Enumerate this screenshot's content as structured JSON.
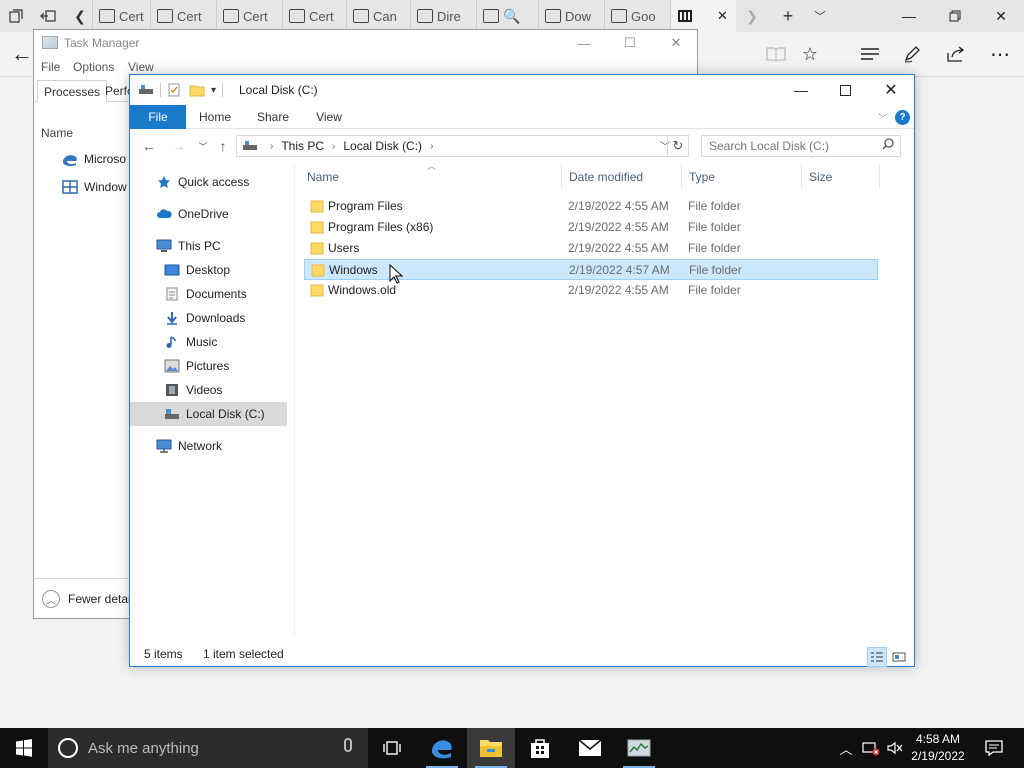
{
  "edge": {
    "tabs": [
      {
        "label": "Cert",
        "favicon": "page-icon"
      },
      {
        "label": "Cert",
        "favicon": "page-icon"
      },
      {
        "label": "Cert",
        "favicon": "page-icon"
      },
      {
        "label": "Cert",
        "favicon": "page-icon"
      },
      {
        "label": "Can",
        "favicon": "page-icon"
      },
      {
        "label": "Dire",
        "favicon": "page-icon"
      },
      {
        "label": "",
        "favicon": "search-icon"
      },
      {
        "label": "Dow",
        "favicon": "page-icon"
      },
      {
        "label": "Goo",
        "favicon": "page-icon"
      }
    ],
    "active_tab_icon": "library-icon"
  },
  "task_manager": {
    "title": "Task Manager",
    "menu": [
      "File",
      "Options",
      "View"
    ],
    "tabs": [
      "Processes",
      "Perfo"
    ],
    "column_header": "Name",
    "rows": [
      {
        "label": "Microso",
        "icon": "edge-icon"
      },
      {
        "label": "Window",
        "icon": "explorer-icon"
      }
    ],
    "footer": "Fewer detai"
  },
  "explorer": {
    "title": "Local Disk (C:)",
    "ribbon_tabs": [
      "File",
      "Home",
      "Share",
      "View"
    ],
    "address": [
      "This PC",
      "Local Disk (C:)"
    ],
    "search_placeholder": "Search Local Disk (C:)",
    "nav": {
      "quick_access": "Quick access",
      "onedrive": "OneDrive",
      "this_pc": "This PC",
      "desktop": "Desktop",
      "documents": "Documents",
      "downloads": "Downloads",
      "music": "Music",
      "pictures": "Pictures",
      "videos": "Videos",
      "local_disk": "Local Disk (C:)",
      "network": "Network"
    },
    "columns": {
      "name": "Name",
      "date": "Date modified",
      "type": "Type",
      "size": "Size"
    },
    "files": [
      {
        "name": "Program Files",
        "date": "2/19/2022 4:55 AM",
        "type": "File folder"
      },
      {
        "name": "Program Files (x86)",
        "date": "2/19/2022 4:55 AM",
        "type": "File folder"
      },
      {
        "name": "Users",
        "date": "2/19/2022 4:55 AM",
        "type": "File folder"
      },
      {
        "name": "Windows",
        "date": "2/19/2022 4:57 AM",
        "type": "File folder"
      },
      {
        "name": "Windows.old",
        "date": "2/19/2022 4:55 AM",
        "type": "File folder"
      }
    ],
    "selected_file": "Windows",
    "status_items": "5 items",
    "status_selected": "1 item selected"
  },
  "taskbar": {
    "search_placeholder": "Ask me anything",
    "time": "4:58 AM",
    "date": "2/19/2022"
  },
  "colors": {
    "accent": "#1979ca",
    "selection": "#cce8ff",
    "folder": "#ffd966",
    "taskbar": "#0f0f0f"
  }
}
